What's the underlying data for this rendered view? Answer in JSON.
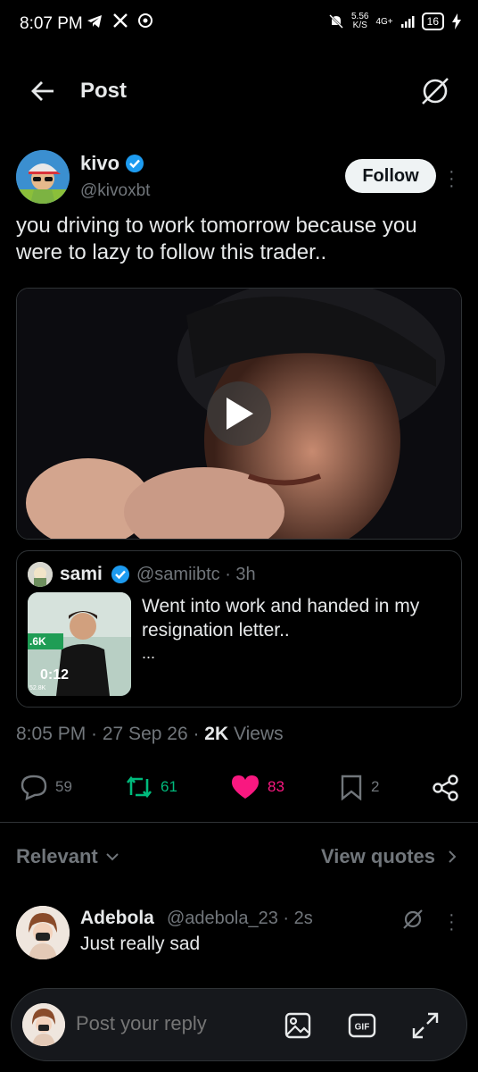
{
  "status": {
    "time": "8:07 PM",
    "net_speed": "5.56",
    "net_unit": "K/S",
    "network": "4G+",
    "battery": "16"
  },
  "header": {
    "title": "Post"
  },
  "post": {
    "author_name": "kivo",
    "author_handle": "@kivoxbt",
    "follow_label": "Follow",
    "text": "you driving to work tomorrow because you were to lazy to follow this trader..",
    "timestamp": "8:05 PM · 27 Sep 26 · ",
    "views_count": "2K",
    "views_label": " Views"
  },
  "quote": {
    "author_name": "sami",
    "author_handle": "@samiibtc · 3h",
    "text": "Went into work and handed in my resignation letter..",
    "ellipsis": "...",
    "thumb_duration": "0:12",
    "thumb_overlay_1": ".6K",
    "thumb_overlay_2": "52.8K"
  },
  "actions": {
    "replies": "59",
    "reposts": "61",
    "likes": "83",
    "bookmarks": "2"
  },
  "colors": {
    "repost": "#00ba7c",
    "like": "#f91880",
    "verified": "#1d9bf0",
    "muted": "#71767b"
  },
  "replies_section": {
    "sort_label": "Relevant",
    "view_quotes_label": "View quotes"
  },
  "comment": {
    "author_name": "Adebola",
    "author_handle": "@adebola_23 · 2s",
    "text": "Just really sad"
  },
  "reply_bar": {
    "placeholder": "Post your reply"
  }
}
